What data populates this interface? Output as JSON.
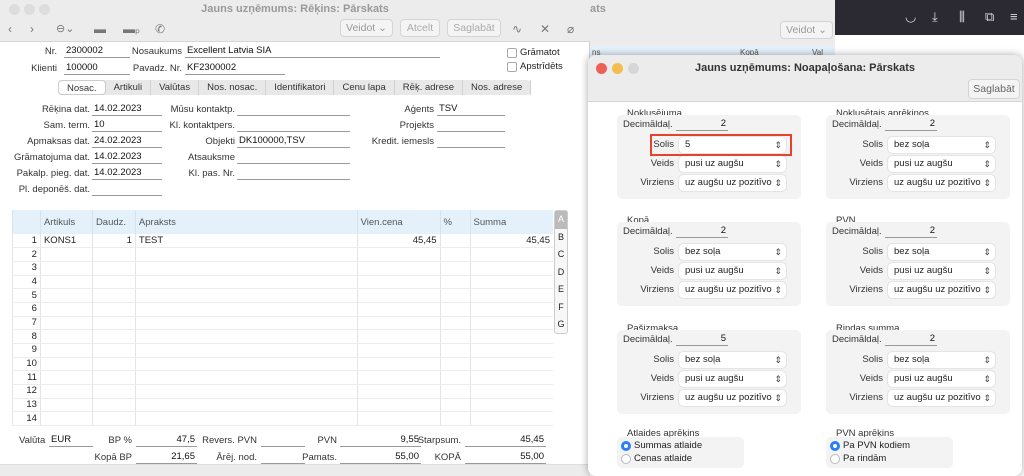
{
  "invoice_window": {
    "title": "Jauns uzņēmums: Rēķins: Pārskats",
    "toolbar": {
      "create": "Veidot",
      "cancel": "Atcelt",
      "save": "Saglabāt"
    },
    "header": {
      "nr_label": "Nr.",
      "nr": "2300002",
      "name_label": "Nosaukums",
      "name": "Excellent Latvia SIA",
      "client_label": "Klienti",
      "client": "100000",
      "waybill_label": "Pavadz. Nr.",
      "waybill": "KF2300002",
      "post_label": "Grāmatot",
      "disputed_label": "Apstrīdēts"
    },
    "tabs": [
      "Nosac.",
      "Artikuli",
      "Valūtas",
      "Nos. nosac.",
      "Identifikatori",
      "Cenu lapa",
      "Rēķ. adrese",
      "Nos. adrese"
    ],
    "fields_left": [
      {
        "label": "Rēķina dat.",
        "value": "14.02.2023"
      },
      {
        "label": "Sam. term.",
        "value": "10"
      },
      {
        "label": "Apmaksas dat.",
        "value": "24.02.2023"
      },
      {
        "label": "Grāmatojuma dat.",
        "value": "14.02.2023"
      },
      {
        "label": "Pakalp. pieg. dat.",
        "value": "14.02.2023"
      },
      {
        "label": "Pl. deponēš. dat.",
        "value": ""
      }
    ],
    "fields_mid": [
      {
        "label": "Mūsu kontaktp.",
        "value": ""
      },
      {
        "label": "Kl. kontaktpers.",
        "value": ""
      },
      {
        "label": "Objekti",
        "value": "DK100000,TSV"
      },
      {
        "label": "Atsauksme",
        "value": ""
      },
      {
        "label": "Kl. pas. Nr.",
        "value": ""
      }
    ],
    "fields_right": [
      {
        "label": "Aģents",
        "value": "TSV"
      },
      {
        "label": "Projekts",
        "value": ""
      },
      {
        "label": "Kredit. iemesls",
        "value": ""
      }
    ],
    "table": {
      "columns": [
        "",
        "Artikuls",
        "Daudz.",
        "Apraksts",
        "Vien.cena",
        "%",
        "Summa"
      ],
      "rows": [
        [
          "1",
          "KONS1",
          "1",
          "TEST",
          "45,45",
          "",
          "45,45"
        ],
        [
          "2",
          "",
          "",
          "",
          "",
          "",
          ""
        ],
        [
          "3",
          "",
          "",
          "",
          "",
          "",
          ""
        ],
        [
          "4",
          "",
          "",
          "",
          "",
          "",
          ""
        ],
        [
          "5",
          "",
          "",
          "",
          "",
          "",
          ""
        ],
        [
          "6",
          "",
          "",
          "",
          "",
          "",
          ""
        ],
        [
          "7",
          "",
          "",
          "",
          "",
          "",
          ""
        ],
        [
          "8",
          "",
          "",
          "",
          "",
          "",
          ""
        ],
        [
          "9",
          "",
          "",
          "",
          "",
          "",
          ""
        ],
        [
          "10",
          "",
          "",
          "",
          "",
          "",
          ""
        ],
        [
          "11",
          "",
          "",
          "",
          "",
          "",
          ""
        ],
        [
          "12",
          "",
          "",
          "",
          "",
          "",
          ""
        ],
        [
          "13",
          "",
          "",
          "",
          "",
          "",
          ""
        ],
        [
          "14",
          "",
          "",
          "",
          "",
          "",
          ""
        ]
      ],
      "letters": [
        "A",
        "B",
        "C",
        "D",
        "E",
        "F",
        "G"
      ]
    },
    "footer": {
      "currency_label": "Valūta",
      "currency": "EUR",
      "gp_pct_label": "BP %",
      "gp_pct": "47,5",
      "reverse_vat_label": "Revers. PVN",
      "reverse_vat": "",
      "vat_label": "PVN",
      "vat": "9,55",
      "subtotal_label": "Starpsum.",
      "subtotal": "45,45",
      "total_gp_label": "Kopā BP",
      "total_gp": "21,65",
      "ext_tax_label": "Ārēj. nod.",
      "ext_tax": "",
      "base_label": "Pamats.",
      "base": "55,00",
      "total_label": "KOPĀ",
      "total": "55,00"
    }
  },
  "background_window": {
    "title_fragment": "ats",
    "create": "Veidot",
    "columns": [
      "ns",
      "Kopā",
      "Val"
    ]
  },
  "browser_icons": [
    "pocket-icon",
    "download-icon",
    "library-icon",
    "extensions-icon",
    "menu-icon"
  ],
  "rounding_dialog": {
    "title": "Jauns uzņēmums: Noapaļošana: Pārskats",
    "save": "Saglabāt",
    "labels": {
      "decimals": "Decimāldaļ.",
      "step": "Solis",
      "type": "Veids",
      "direction": "Virziens"
    },
    "groups": [
      {
        "title": "Noklusējuma",
        "decimals": "2",
        "step": "5",
        "type": "pusi uz augšu",
        "direction": "uz augšu uz pozitīvo",
        "highlighted": true
      },
      {
        "title": "Noklusētais aprēķinos",
        "decimals": "2",
        "step": "bez soļa",
        "type": "pusi uz augšu",
        "direction": "uz augšu uz pozitīvo"
      },
      {
        "title": "Kopā",
        "decimals": "2",
        "step": "bez soļa",
        "type": "pusi uz augšu",
        "direction": "uz augšu uz pozitīvo"
      },
      {
        "title": "PVN",
        "decimals": "2",
        "step": "bez soļa",
        "type": "pusi uz augšu",
        "direction": "uz augšu uz pozitīvo"
      },
      {
        "title": "Pašizmaksa",
        "decimals": "5",
        "step": "bez soļa",
        "type": "pusi uz augšu",
        "direction": "uz augšu uz pozitīvo"
      },
      {
        "title": "Rindas summa",
        "decimals": "2",
        "step": "bez soļa",
        "type": "pusi uz augšu",
        "direction": "uz augšu uz pozitīvo"
      }
    ],
    "discount": {
      "title": "Atlaides aprēķins",
      "options": [
        "Summas atlaide",
        "Cenas atlaide"
      ],
      "selected": 0
    },
    "vat_calc": {
      "title": "PVN aprēķins",
      "options": [
        "Pa PVN kodiem",
        "Pa rindām"
      ],
      "selected": 0
    },
    "highlight_color": "#e8412c"
  }
}
